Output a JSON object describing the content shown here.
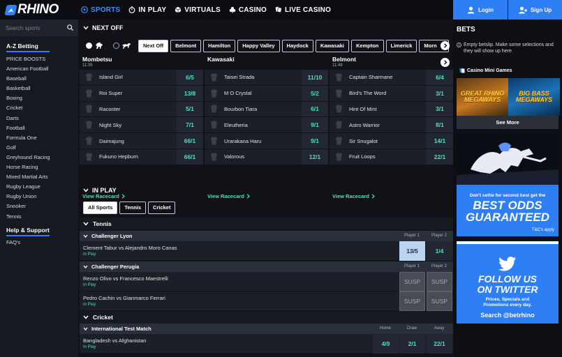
{
  "header": {
    "logo_text": "RHINO",
    "nav": [
      {
        "label": "SPORTS",
        "icon": "football-icon",
        "active": true
      },
      {
        "label": "IN PLAY",
        "icon": "stopwatch-icon",
        "active": false
      },
      {
        "label": "VIRTUALS",
        "icon": "cube-icon",
        "active": false
      },
      {
        "label": "CASINO",
        "icon": "clubs-icon",
        "active": false
      },
      {
        "label": "LIVE CASINO",
        "icon": "card-hand-icon",
        "active": false
      }
    ],
    "login_label": "Login",
    "signup_label": "Sign Up",
    "accent": "#2f7ff4"
  },
  "sidebar": {
    "search_placeholder": "Search sports",
    "az_title": "A-Z Betting",
    "items": [
      "PRICE BOOSTS",
      "American Football",
      "Baseball",
      "Basketball",
      "Boxing",
      "Cricket",
      "Darts",
      "Football",
      "Formula One",
      "Golf",
      "Greyhound Racing",
      "Horse Racing",
      "Mixed Martial Arts",
      "Rugby League",
      "Rugby Union",
      "Snooker",
      "Tennis"
    ],
    "help_title": "Help & Support",
    "help_items": [
      "FAQ's"
    ]
  },
  "next_off": {
    "title": "NEXT OFF",
    "filters": [
      "Next Off",
      "Belmont",
      "Hamilton",
      "Happy Valley",
      "Haydock",
      "Kawasaki",
      "Kempton",
      "Limerick",
      "Morn"
    ],
    "active_filter": "Next Off",
    "races": [
      {
        "course": "Mombetsu",
        "time": "11:35",
        "runners": [
          {
            "name": "Island Girl",
            "odds": "6/5"
          },
          {
            "name": "Roi Super",
            "odds": "13/8"
          },
          {
            "name": "Raconter",
            "odds": "5/1"
          },
          {
            "name": "Night Sky",
            "odds": "7/1"
          },
          {
            "name": "Daimajung",
            "odds": "66/1"
          },
          {
            "name": "Fukuno Hepburn",
            "odds": "66/1"
          }
        ]
      },
      {
        "course": "Kawasaki",
        "time": "",
        "runners": [
          {
            "name": "Taisei Strada",
            "odds": "11/10"
          },
          {
            "name": "M O Crystal",
            "odds": "5/2"
          },
          {
            "name": "Bourbon Tiara",
            "odds": "6/1"
          },
          {
            "name": "Eleutheria",
            "odds": "9/1"
          },
          {
            "name": "Urarakana Haru",
            "odds": "9/1"
          },
          {
            "name": "Valorous",
            "odds": "12/1"
          }
        ]
      },
      {
        "course": "Belmont",
        "time": "11:48",
        "runners": [
          {
            "name": "Captain Sharmane",
            "odds": "6/4"
          },
          {
            "name": "Bird's The Word",
            "odds": "3/1"
          },
          {
            "name": "Hint Of Mint",
            "odds": "3/1"
          },
          {
            "name": "Astro Warrior",
            "odds": "8/1"
          },
          {
            "name": "Sir Snugalot",
            "odds": "14/1"
          },
          {
            "name": "Fruit Loops",
            "odds": "22/1"
          }
        ]
      }
    ],
    "view_racecard": "View Racecard"
  },
  "in_play": {
    "title": "IN PLAY",
    "filters": [
      "All Sports",
      "Tennis",
      "Cricket"
    ],
    "tennis": {
      "title": "Tennis",
      "competitions": [
        {
          "name": "Challenger Lyon",
          "col1": "Player 1",
          "col2": "Player 2",
          "matches": [
            {
              "name": "Clement Tabur vs Alejandro Moro Canas",
              "status": "In Play",
              "p1": "13/5",
              "p2": "1/4"
            }
          ]
        },
        {
          "name": "Challenger Perugia",
          "col1": "Player 1",
          "col2": "Player 2",
          "matches": [
            {
              "name": "Renzo Olivo vs Francesco Maestrelli",
              "status": "In Play",
              "p1": "SUSP",
              "p2": "SUSP"
            },
            {
              "name": "Pedro Cachin vs Gianmarco Ferrari",
              "status": "In Play",
              "p1": "SUSP",
              "p2": "SUSP"
            }
          ]
        }
      ]
    },
    "cricket": {
      "title": "Cricket",
      "competition": {
        "name": "International Test Match",
        "col1": "Home",
        "col2": "Draw",
        "col3": "Away",
        "match": {
          "name": "Bangladesh vs Afghanistan",
          "status": "In Play",
          "home": "4/9",
          "draw": "2/1",
          "away": "22/1"
        }
      }
    }
  },
  "bets": {
    "title": "BETS",
    "empty_text": "Empty betslip. Make some selections and they will show up here",
    "mini_games_title": "Casino Mini Games",
    "games": [
      "GREAT RHINO MEGAWAYS",
      "BIG BASS MEGAWAYS"
    ],
    "see_more": "See More",
    "promo1_small": "Don't settle for second best get the",
    "promo1_big1": "BEST ODDS",
    "promo1_big2": "GUARANTEED",
    "promo1_tc": "T&C's apply",
    "promo2_big1": "FOLLOW US",
    "promo2_big2": "ON TWITTER",
    "promo2_small": "Prices, Specials and Promotions every day.",
    "promo2_search": "Search @betrhino"
  }
}
